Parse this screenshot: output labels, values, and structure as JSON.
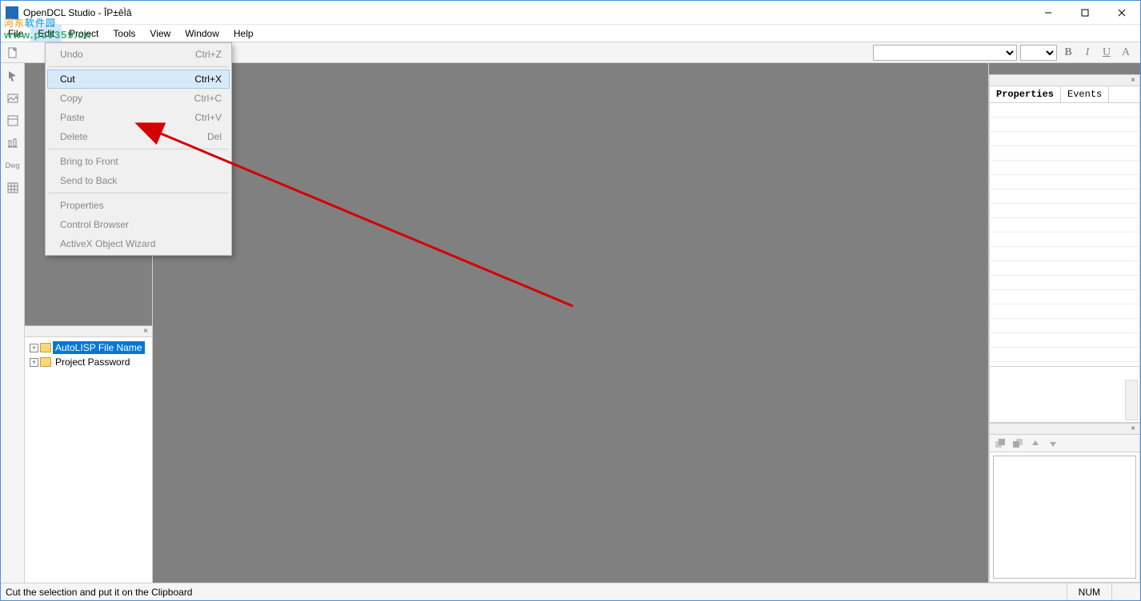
{
  "title": "OpenDCL Studio - ÎP±êÌâ",
  "watermark": {
    "line1_a": "河东",
    "line1_b": "软件园",
    "line2": "www.pc0359.cn"
  },
  "menubar": [
    "File",
    "Edit",
    "Project",
    "Tools",
    "View",
    "Window",
    "Help"
  ],
  "open_menu_index": 1,
  "edit_menu": {
    "sections": [
      [
        {
          "label": "Undo",
          "shortcut": "Ctrl+Z",
          "enabled": false
        }
      ],
      [
        {
          "label": "Cut",
          "shortcut": "Ctrl+X",
          "enabled": true,
          "hover": true
        },
        {
          "label": "Copy",
          "shortcut": "Ctrl+C",
          "enabled": false
        },
        {
          "label": "Paste",
          "shortcut": "Ctrl+V",
          "enabled": false
        },
        {
          "label": "Delete",
          "shortcut": "Del",
          "enabled": false
        }
      ],
      [
        {
          "label": "Bring to Front",
          "shortcut": "",
          "enabled": false
        },
        {
          "label": "Send to Back",
          "shortcut": "",
          "enabled": false
        }
      ],
      [
        {
          "label": "Properties",
          "shortcut": "",
          "enabled": false
        },
        {
          "label": "Control Browser",
          "shortcut": "",
          "enabled": false
        },
        {
          "label": "ActiveX Object Wizard",
          "shortcut": "",
          "enabled": false
        }
      ]
    ]
  },
  "vtoolbox": [
    {
      "name": "pointer-icon"
    },
    {
      "name": "picture-icon"
    },
    {
      "name": "form-icon"
    },
    {
      "name": "align-icon"
    },
    {
      "name": "dwg-icon",
      "text": "Dwg"
    },
    {
      "name": "grid-icon"
    }
  ],
  "tree": {
    "items": [
      {
        "label": "AutoLISP File Name",
        "selected": true
      },
      {
        "label": "Project Password",
        "selected": false
      }
    ]
  },
  "right": {
    "tabs": {
      "properties": "Properties",
      "events": "Events"
    },
    "active_tab": "properties"
  },
  "format_buttons": {
    "bold": "B",
    "italic": "I",
    "underline": "U",
    "align": "A"
  },
  "statusbar": {
    "hint": "Cut the selection and put it on the Clipboard",
    "num": "NUM"
  }
}
